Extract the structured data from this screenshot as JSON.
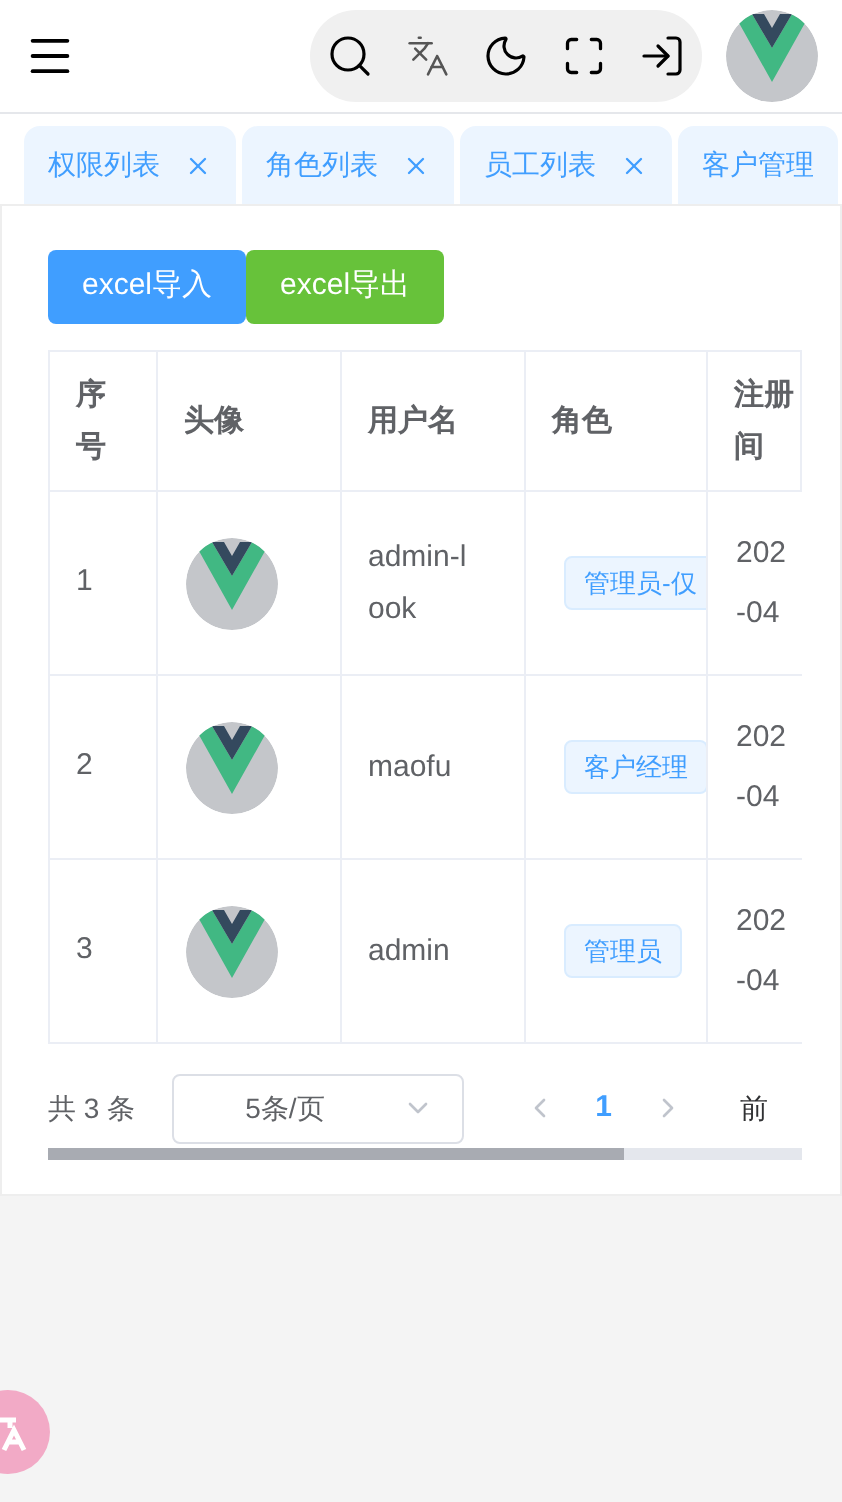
{
  "tabs": [
    {
      "label": "权限列表",
      "selected": false,
      "closable": true
    },
    {
      "label": "角色列表",
      "selected": false,
      "closable": true
    },
    {
      "label": "员工列表",
      "selected": false,
      "closable": true
    },
    {
      "label": "客户管理",
      "selected": false,
      "closable": false
    }
  ],
  "toolbar": {
    "buttons": [
      {
        "label": "excel导入",
        "kind": "primary"
      },
      {
        "label": "excel导出",
        "kind": "success"
      }
    ]
  },
  "table": {
    "columns": [
      {
        "lines": [
          "序",
          "号"
        ]
      },
      {
        "lines": [
          "头像"
        ]
      },
      {
        "lines": [
          "用户名"
        ]
      },
      {
        "lines": [
          "角色"
        ]
      },
      {
        "lines": [
          "注册",
          "间"
        ]
      }
    ],
    "rows": [
      {
        "index": "1",
        "username": [
          "admin-l",
          "ook"
        ],
        "role": "管理员-仅",
        "date": [
          "202",
          "-04"
        ]
      },
      {
        "index": "2",
        "username": [
          "maofu"
        ],
        "role": "客户经理",
        "date": [
          "202",
          "-04"
        ]
      },
      {
        "index": "3",
        "username": [
          "admin"
        ],
        "role": "管理员",
        "date": [
          "202",
          "-04"
        ]
      }
    ]
  },
  "pagination": {
    "total": "共 3 条",
    "page_size": "5条/页",
    "pages": [
      {
        "label": "1",
        "selected": true
      }
    ],
    "goto": "前"
  }
}
